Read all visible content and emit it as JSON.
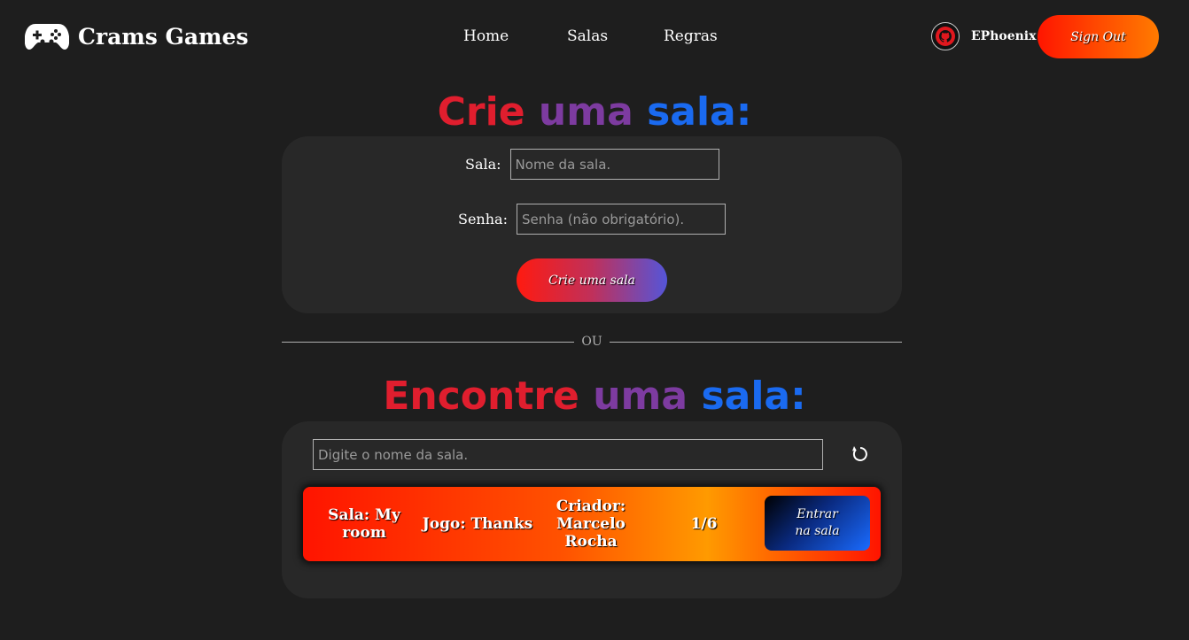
{
  "header": {
    "brand": "Crams Games",
    "nav": [
      "Home",
      "Salas",
      "Regras"
    ],
    "username": "EPhoenix",
    "signout_label": "Sign Out"
  },
  "create_section": {
    "title_words": [
      "Crie",
      "uma",
      "sala:"
    ],
    "room_label": "Sala:",
    "room_placeholder": "Nome da sala.",
    "password_label": "Senha:",
    "password_placeholder": "Senha (não obrigatório).",
    "create_button": "Crie uma sala"
  },
  "divider_text": "OU",
  "find_section": {
    "title_words": [
      "Encontre",
      "uma",
      "sala:"
    ],
    "search_placeholder": "Digite o nome da sala.",
    "rooms": [
      {
        "room_line1": "Sala: My",
        "room_line2": "room",
        "game": "Jogo: Thanks",
        "creator_line1": "Criador:",
        "creator_line2": "Marcelo",
        "creator_line3": "Rocha",
        "players": "1/6",
        "enter_line1": "Entrar",
        "enter_line2": "na sala"
      }
    ]
  },
  "colors": {
    "background": "#1e1e1e",
    "panel": "#282828",
    "title_red": "#e01e2e",
    "title_purple": "#7d3ba0",
    "title_blue": "#1a6af0",
    "accent_orange": "#ff4a00"
  }
}
